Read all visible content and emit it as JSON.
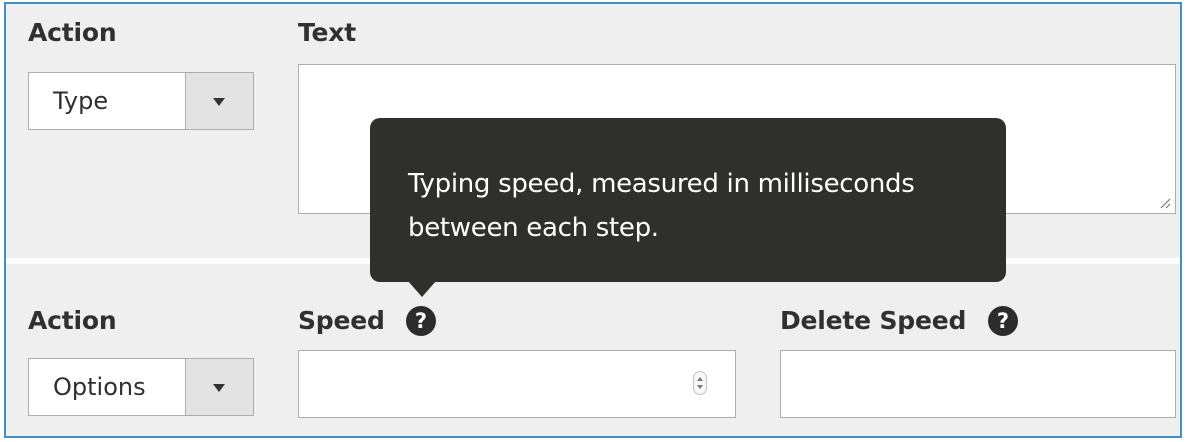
{
  "row1": {
    "action_label": "Action",
    "action_value": "Type",
    "text_label": "Text",
    "text_value": ""
  },
  "row2": {
    "action_label": "Action",
    "action_value": "Options",
    "speed_label": "Speed",
    "speed_value": "",
    "delete_speed_label": "Delete Speed",
    "delete_speed_value": ""
  },
  "help_glyph": "?",
  "tooltip": {
    "text": "Typing speed, measured in milliseconds between each step."
  },
  "colors": {
    "frame_border": "#3d8fc6",
    "panel_bg": "#efefef",
    "tooltip_bg": "#2f2f2c",
    "text": "#303030"
  },
  "icons": [
    "chevron-down-icon",
    "help-icon",
    "resize-handle-icon",
    "spinner-icon"
  ]
}
